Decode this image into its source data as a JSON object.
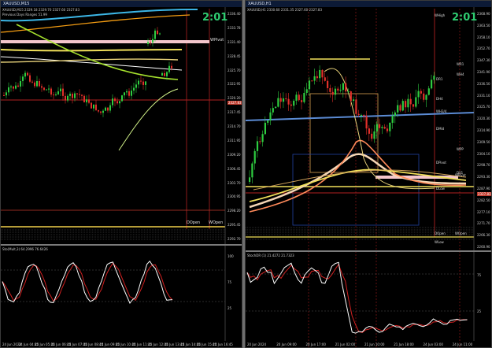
{
  "left": {
    "title": "XAUUSD,M15",
    "info_lines": [
      "XAUUSD,M15  2329.18 2329.70 2327.60 2327.83",
      "Previous Days Ranges 51.99"
    ],
    "timer": "2:01",
    "price_tag": "2327.83",
    "level_labels": [
      "WPivot",
      "DOpen",
      "WOpen"
    ],
    "y_ticks": [
      "2336.40",
      "2333.78",
      "2331.40",
      "2328.45",
      "2325.70",
      "2322.95",
      "2320.20",
      "2317.45",
      "2314.70",
      "2311.95",
      "2309.20",
      "2306.45",
      "2303.70",
      "2300.95",
      "2298.20",
      "2295.45",
      "2292.70"
    ],
    "x_ticks": [
      "24 Jun 2024",
      "24 Jun 04:45",
      "24 Jun 05:45",
      "24 Jun 06:45",
      "24 Jun 07:45",
      "24 Jun 08:45",
      "24 Jun 09:45",
      "24 Jun 10:45",
      "24 Jun 11:45",
      "24 Jun 12:45",
      "24 Jun 13:45",
      "24 Jun 14:45",
      "24 Jun 15:45",
      "24 Jun 16:45"
    ],
    "indicator_label": "Sto(Mult,3) 64.2996 76.6426",
    "indicator_ticks": [
      "100",
      "75",
      "25"
    ]
  },
  "right": {
    "title": "XAUUSD,H1",
    "info_line": "XAUUSD,H1  2330.60 2331.35 2327.60 2327.83",
    "timer": "2:01",
    "price_tag": "2327.83",
    "level_labels": [
      "WHigh",
      "WR1",
      "WH4",
      "DR1",
      "DH4",
      "WH3/4",
      "DMid",
      "WPP",
      "DPivot",
      "DS1",
      "WPivot",
      "DLow",
      "DOpen",
      "WOpen",
      "WLow"
    ],
    "y_ticks": [
      "2368.90",
      "2363.50",
      "2358.10",
      "2352.70",
      "2347.30",
      "2341.90",
      "2336.50",
      "2331.10",
      "2325.70",
      "2320.30",
      "2314.90",
      "2309.50",
      "2304.10",
      "2298.70",
      "2293.30",
      "2287.90",
      "2282.50",
      "2277.10",
      "2271.70",
      "2266.30",
      "2260.90"
    ],
    "x_ticks": [
      "20 Jun 2024",
      "20 Jun 09:00",
      "20 Jun 17:00",
      "21 Jun 02:00",
      "21 Jun 10:00",
      "21 Jun 18:00",
      "24 Jun 03:00",
      "24 Jun 11:00"
    ],
    "indicator_label": "StochDR (1) 21.4272 21.7323",
    "indicator_ticks": [
      "75",
      "25"
    ]
  },
  "colors": {
    "bull": "#2ecc40",
    "bear": "#e0302a",
    "grid": "#3a3a3a",
    "timer": "#2ecc71",
    "stoch_main": "#ffffff",
    "stoch_signal": "#d32020"
  }
}
